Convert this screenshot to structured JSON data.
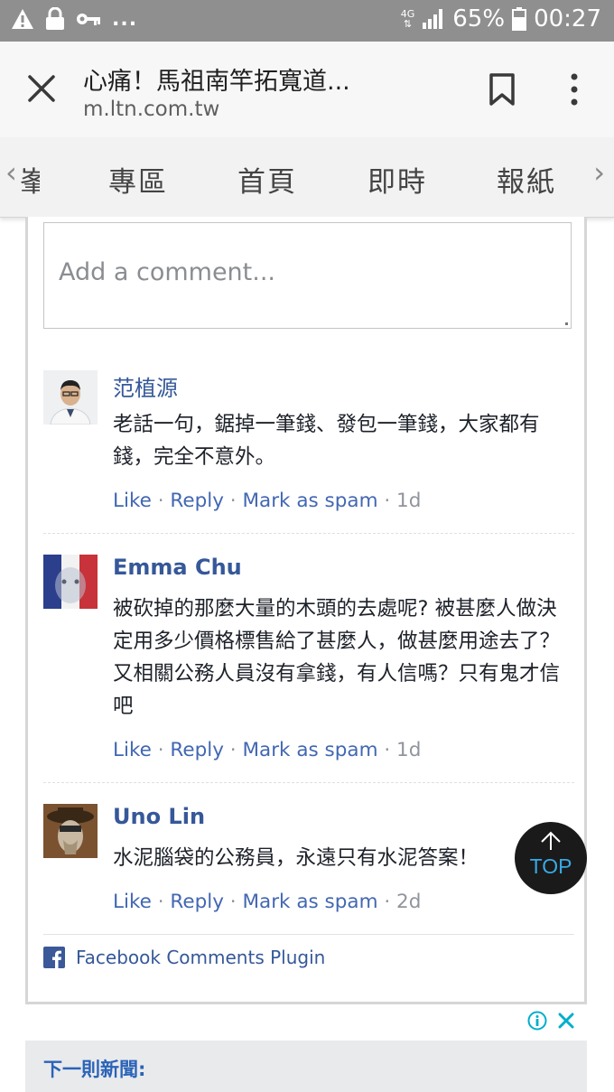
{
  "status_bar": {
    "network": "4G",
    "battery": "65%",
    "time": "00:27",
    "more": "...",
    "icons": [
      "warning-icon",
      "lock-icon",
      "key-icon",
      "signal-icon",
      "battery-icon"
    ]
  },
  "browser": {
    "title": "心痛！馬祖南竿拓寬道...",
    "url": "m.ltn.com.tw"
  },
  "nav": {
    "partial_tab": "峯",
    "tabs": [
      "專區",
      "首頁",
      "即時",
      "報紙"
    ],
    "left_arrow": "‹",
    "right_arrow": "›"
  },
  "comment_box": {
    "placeholder": "Add a comment..."
  },
  "comments": [
    {
      "author": "范植源",
      "text": "老話一句，鋸掉一筆錢、發包一筆錢，大家都有錢，完全不意外。",
      "like": "Like",
      "reply": "Reply",
      "spam": "Mark as spam",
      "time": "1d"
    },
    {
      "author": "Emma Chu",
      "text": "被砍掉的那麼大量的木頭的去處呢? 被甚麼人做決定用多少價格標售給了甚麼人，做甚麼用途去了？又相關公務人員沒有拿錢，有人信嗎？只有鬼才信吧",
      "like": "Like",
      "reply": "Reply",
      "spam": "Mark as spam",
      "time": "1d"
    },
    {
      "author": "Uno Lin",
      "text": "水泥腦袋的公務員，永遠只有水泥答案！",
      "like": "Like",
      "reply": "Reply",
      "spam": "Mark as spam",
      "time": "2d"
    }
  ],
  "action_separator": "·",
  "fb_plugin_label": "Facebook Comments Plugin",
  "top_button_label": "TOP",
  "next_news_label": "下一則新聞:",
  "colors": {
    "fb_blue": "#365899",
    "link_blue": "#4267b2",
    "status_bar": "#8f8f8f",
    "top_button_bg": "#1a1a1a",
    "top_button_fg": "#37a9e6"
  }
}
